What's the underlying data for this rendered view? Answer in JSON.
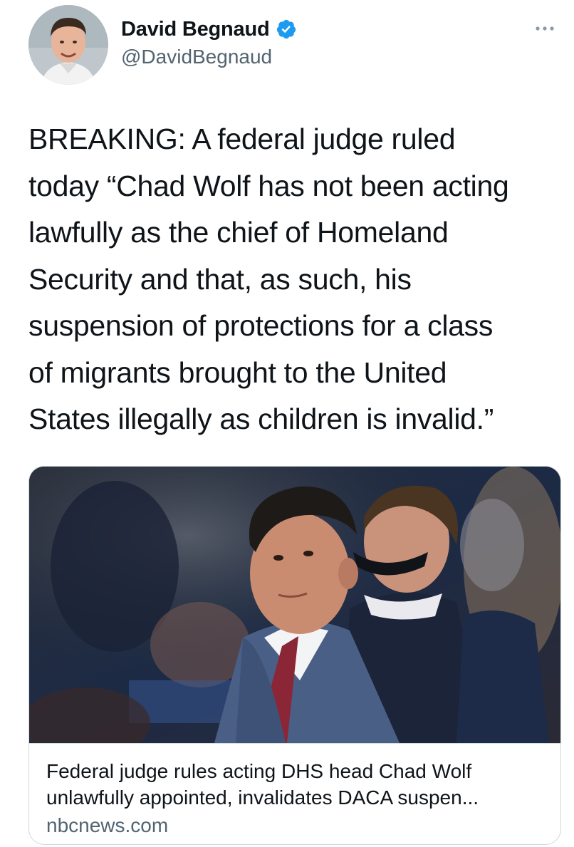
{
  "author": {
    "display_name": "David Begnaud",
    "handle": "@DavidBegnaud",
    "verified": true,
    "avatar_icon": "profile-photo"
  },
  "more_icon": "ellipsis-icon",
  "tweet": {
    "text": "BREAKING: A federal judge ruled\ntoday “Chad Wolf has not been acting\nlawfully as the chief of Homeland\nSecurity and that, as such, his\nsuspension of protections for a class\nof migrants brought to the United\nStates illegally as children is invalid.”"
  },
  "card": {
    "title": "Federal judge rules acting DHS head Chad Wolf\nunlawfully appointed, invalidates DACA suspen...",
    "domain": "nbcnews.com"
  },
  "colors": {
    "verified_blue": "#1d9bf0",
    "secondary_text": "#536471",
    "border": "#cfd9de"
  }
}
